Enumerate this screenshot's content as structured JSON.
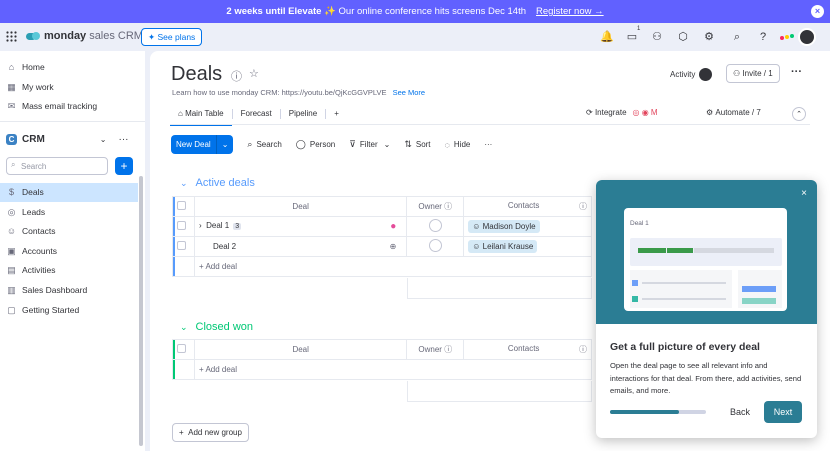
{
  "banner": {
    "bold_text": "2 weeks until Elevate",
    "text": "✨ Our online conference hits screens Dec 14th",
    "link": "Register now →"
  },
  "topbar": {
    "brand": "monday",
    "product": "sales CRM",
    "see_plans": "See plans",
    "inbox_badge": "1"
  },
  "sidebar": {
    "items": [
      {
        "label": "Home",
        "icon": "home-icon"
      },
      {
        "label": "My work",
        "icon": "calendar-icon"
      },
      {
        "label": "Mass email tracking",
        "icon": "email-icon"
      }
    ],
    "workspace": "CRM",
    "workspace_letter": "C",
    "search_placeholder": "Search",
    "boards": [
      {
        "label": "Deals",
        "active": true
      },
      {
        "label": "Leads"
      },
      {
        "label": "Contacts"
      },
      {
        "label": "Accounts"
      },
      {
        "label": "Activities"
      },
      {
        "label": "Sales Dashboard"
      },
      {
        "label": "Getting Started"
      }
    ]
  },
  "board": {
    "title": "Deals",
    "subtitle": "Learn how to use monday CRM: https://youtu.be/QjKcGGVPLVE",
    "see_more": "See More",
    "activity": "Activity",
    "invite": "Invite / 1",
    "tabs": [
      "Main Table",
      "Forecast",
      "Pipeline",
      "+"
    ],
    "integrate": "Integrate",
    "automate": "Automate / 7",
    "toolbar": {
      "new_deal": "New Deal",
      "search": "Search",
      "person": "Person",
      "filter": "Filter",
      "sort": "Sort",
      "hide": "Hide",
      "more": "···"
    },
    "groups": [
      {
        "title": "Active deals",
        "color": "#579bfc",
        "columns": {
          "deal": "Deal",
          "owner": "Owner",
          "contacts": "Contacts"
        },
        "rows": [
          {
            "deal": "Deal 1",
            "count": "3",
            "contact": "Madison Doyle"
          },
          {
            "deal": "Deal 2",
            "contact": "Leilani Krause"
          }
        ],
        "add": "+ Add deal"
      },
      {
        "title": "Closed won",
        "color": "#00c875",
        "columns": {
          "deal": "Deal",
          "owner": "Owner",
          "contacts": "Contacts"
        },
        "rows": [],
        "add": "+ Add deal"
      }
    ],
    "add_group": "Add new group"
  },
  "popup": {
    "card_title": "Deal 1",
    "heading": "Get a full picture of every deal",
    "body": "Open the deal page to see all relevant info and interactions for that deal. From there, add activities, send emails, and more.",
    "back": "Back",
    "next": "Next",
    "progress": 0.72,
    "accent": "#2b7d94"
  }
}
